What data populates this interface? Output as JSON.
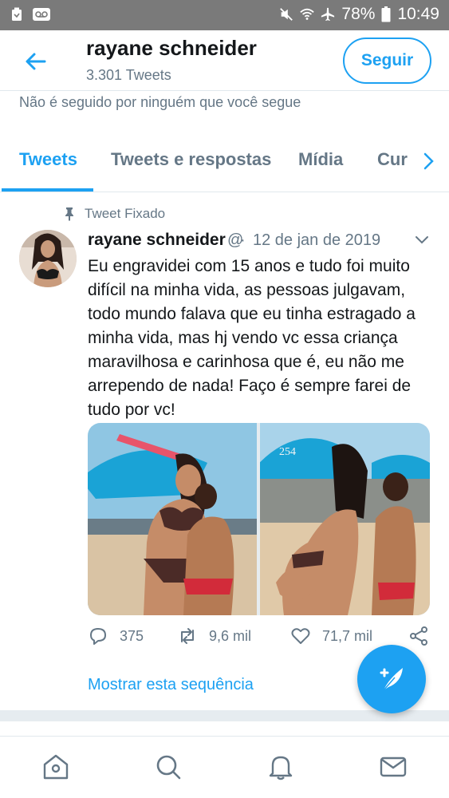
{
  "status_bar": {
    "battery_percent": "78%",
    "time": "10:49",
    "icons": [
      "cleaner-icon",
      "voicemail-icon",
      "mute-icon",
      "wifi-icon",
      "airplane-icon",
      "battery-icon"
    ]
  },
  "header": {
    "title": "rayane schneider",
    "tweet_count": "3.301 Tweets",
    "follow_label": "Seguir"
  },
  "profile": {
    "not_followed_text": "Não é seguido por ninguém que você segue"
  },
  "tabs": [
    {
      "label": "Tweets",
      "active": true
    },
    {
      "label": "Tweets e respostas",
      "active": false
    },
    {
      "label": "Mídia",
      "active": false
    },
    {
      "label": "Cur",
      "active": false
    }
  ],
  "tweet": {
    "pinned_label": "Tweet Fixado",
    "author_name": "rayane schneider",
    "handle": "@",
    "separator": "·",
    "date": "12 de jan de 2019",
    "text": "Eu engravidei com 15 anos e tudo foi muito difícil na minha vida, as pessoas julgavam, todo mundo falava que eu tinha estragado a minha vida, mas hj vendo vc essa criança maravilhosa e carinhosa que é, eu não me arrependo de nada! Faço é sempre farei de tudo por vc!",
    "umbrella_number": "254",
    "replies": "375",
    "retweets": "9,6 mil",
    "likes": "71,7 mil",
    "show_thread": "Mostrar esta sequência"
  },
  "bottom_nav": [
    "home-icon",
    "search-icon",
    "notifications-icon",
    "messages-icon"
  ],
  "colors": {
    "accent": "#1da1f2",
    "secondary_text": "#657786",
    "status_bar": "#7a7a7a",
    "divider": "#e1e8ed"
  }
}
